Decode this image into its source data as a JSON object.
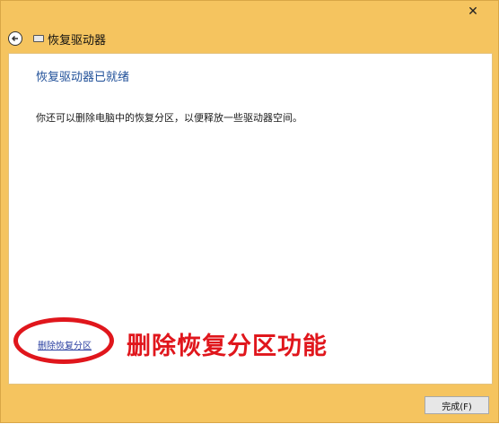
{
  "window": {
    "title": "恢复驱动器",
    "close_glyph": "✕"
  },
  "content": {
    "heading": "恢复驱动器已就绪",
    "body": "你还可以删除电脑中的恢复分区，以便释放一些驱动器空间。",
    "delete_link": "删除恢复分区"
  },
  "annotation": {
    "text": "删除恢复分区功能",
    "color": "#e0161c"
  },
  "footer": {
    "finish_label": "完成(F)"
  },
  "colors": {
    "titlebar": "#f5c45f",
    "heading": "#1f4f98",
    "link": "#2a3fa0"
  }
}
